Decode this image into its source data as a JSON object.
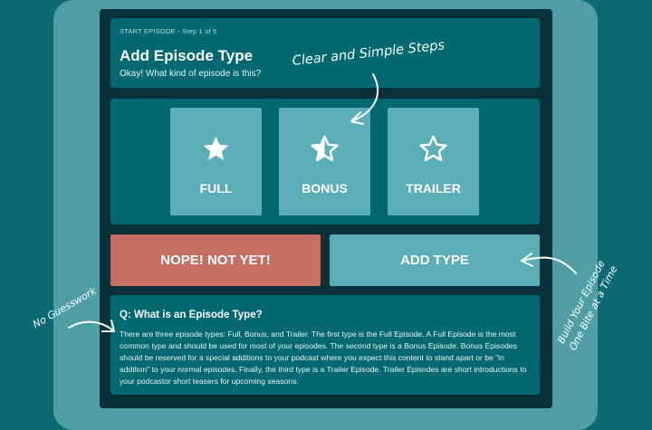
{
  "header": {
    "step_label": "START EPISODE - Step 1 of 5",
    "title": "Add Episode Type",
    "subtitle": "Okay! What kind of episode is this?"
  },
  "episode_types": [
    {
      "label": "FULL",
      "icon": "star-filled-icon"
    },
    {
      "label": "BONUS",
      "icon": "star-half-icon"
    },
    {
      "label": "TRAILER",
      "icon": "star-outline-icon"
    }
  ],
  "actions": {
    "cancel_label": "NOPE! NOT YET!",
    "add_label": "ADD TYPE"
  },
  "faq": {
    "question": "Q: What is an Episode Type?",
    "answer": "There are three episode types: Full, Bonus, and Trailer. The first type is the Full Episode. A Full Episode is the most common type and should be used for most of your episodes. The second type is a Bonus Episode. Bonus Episodes should be reserved for a special additions to your podcast where you expect this content to stand apart or be \"in addition\" to your normal episodes. Finally, the third type is a Trailer Episode. Trailer Episodes are short introductions to your podcastor short teasers for upcoming seasons."
  },
  "annotations": {
    "clear_steps": "Clear and Simple Steps",
    "no_guesswork": "No Guesswork",
    "build_line1": "Build Your Episode",
    "build_line2": "One Bite at a Time"
  },
  "colors": {
    "background": "#0d6a72",
    "panel": "#006870",
    "card": "#5aaeb8",
    "cancel": "#c66f62"
  }
}
